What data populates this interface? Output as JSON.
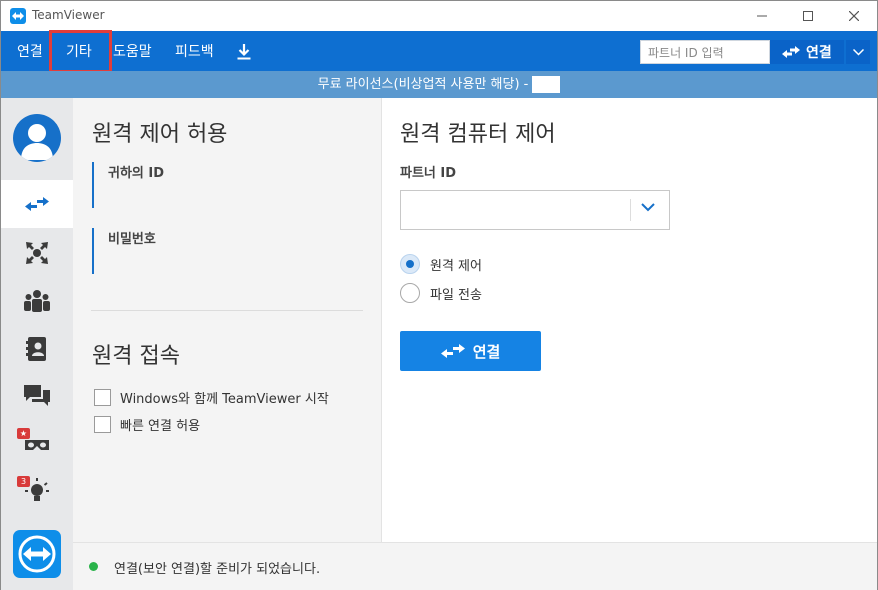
{
  "window": {
    "title": "TeamViewer",
    "minimize_icon": "minimize-icon",
    "maximize_icon": "maximize-icon",
    "close_icon": "close-icon"
  },
  "menu": {
    "items": [
      "연결",
      "기타",
      "도움말",
      "피드백"
    ],
    "highlighted_index": 1,
    "download_icon": "download-icon",
    "partner_input_placeholder": "파트너 ID 입력",
    "connect_label": "연결"
  },
  "license": {
    "text": "무료 라이선스(비상업적 사용만 해당) -"
  },
  "sidebar": {
    "icons": [
      "remote-control-icon",
      "meeting-icon",
      "group-icon",
      "contacts-icon",
      "chat-icon",
      "augmented-reality-icon",
      "idea-icon"
    ],
    "active_index": 0,
    "idea_badge": "3"
  },
  "allow_remote": {
    "title": "원격 제어 허용",
    "your_id_label": "귀하의 ID",
    "password_label": "비밀번호"
  },
  "unattended": {
    "title": "원격 접속",
    "option1": "Windows와 함께 TeamViewer 시작",
    "option2": "빠른 연결 허용"
  },
  "control_remote": {
    "title": "원격 컴퓨터 제어",
    "partner_id_label": "파트너 ID",
    "partner_id_value": "",
    "radio_remote": "원격 제어",
    "radio_file": "파일 전송",
    "selected": "원격 제어",
    "connect_label": "연결"
  },
  "status": {
    "text": "연결(보안 연결)할 준비가 되었습니다.",
    "color": "#2ab34a"
  },
  "colors": {
    "accent": "#0e6fd1",
    "button": "#1583e4",
    "highlight_frame": "#e23d3a"
  }
}
